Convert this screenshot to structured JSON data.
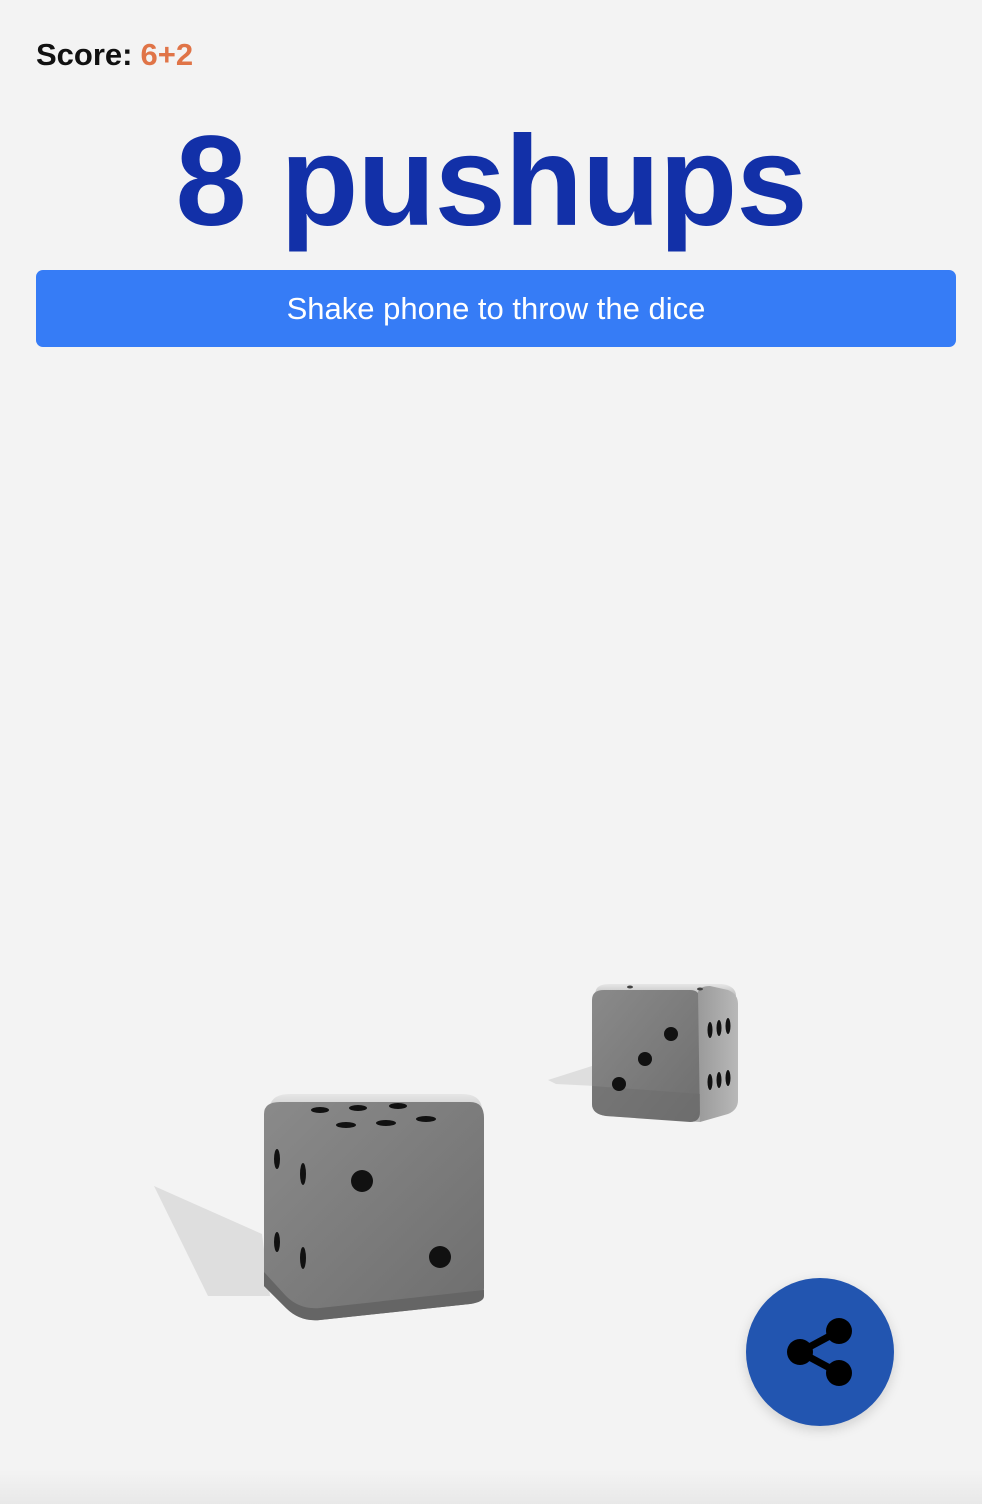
{
  "score": {
    "label": "Score:",
    "value": "6+2"
  },
  "result": {
    "text": "8 pushups"
  },
  "shake_button": {
    "label": "Shake phone to throw the dice"
  },
  "dice": [
    {
      "name": "die-large",
      "top_face": 6,
      "front_face": 3,
      "side_face": 4
    },
    {
      "name": "die-small",
      "top_face": 2,
      "front_face": 3,
      "side_face": 6
    }
  ],
  "share_button": {
    "icon": "share-icon"
  },
  "colors": {
    "background": "#f3f3f3",
    "result_text": "#1230a8",
    "score_value": "#e07447",
    "button": "#367cf6",
    "share_button": "#2255b0",
    "die_face": "#7a7a7a"
  }
}
